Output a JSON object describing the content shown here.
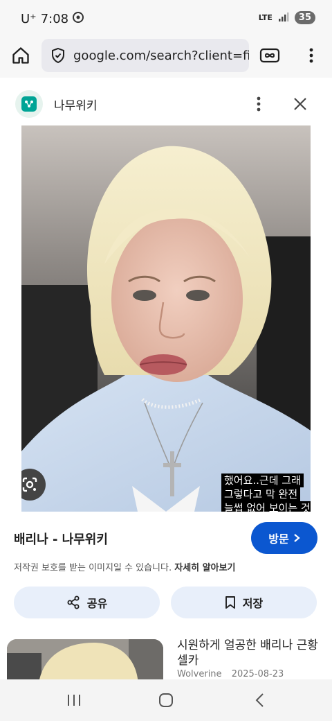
{
  "status_bar": {
    "carrier": "U⁺",
    "time": "7:08",
    "network": "LTE",
    "battery": "35"
  },
  "browser": {
    "url": "google.com/search?client=fire"
  },
  "sheet": {
    "site_name": "나무위키",
    "caption_lines": [
      "했어요..근데 그래",
      "그렇다고 막 완전 ",
      "늘썹 없어 보이는 것"
    ],
    "title": "배리나 - 나무위키",
    "visit_label": "방문",
    "copyright_text": "저작권 보호를 받는 이미지일 수 있습니다.",
    "learn_more": "자세히 알아보기",
    "share_label": "공유",
    "save_label": "저장"
  },
  "related": {
    "title": "시원하게 얼공한 배리나 근황 셀카",
    "source": "Wolverine",
    "date": "2025-08-23"
  },
  "colors": {
    "accent": "#0b57d0",
    "pill_bg": "#e8effa",
    "site_logo": "#00a495"
  },
  "icons": {
    "home": "home-icon",
    "shield": "shield-check-icon",
    "tracking": "infinity-icon",
    "menu": "more-vert-icon",
    "close": "close-icon",
    "lens": "google-lens-icon",
    "share": "share-icon",
    "save": "bookmark-icon",
    "visit_chevron": "chevron-right-icon"
  }
}
